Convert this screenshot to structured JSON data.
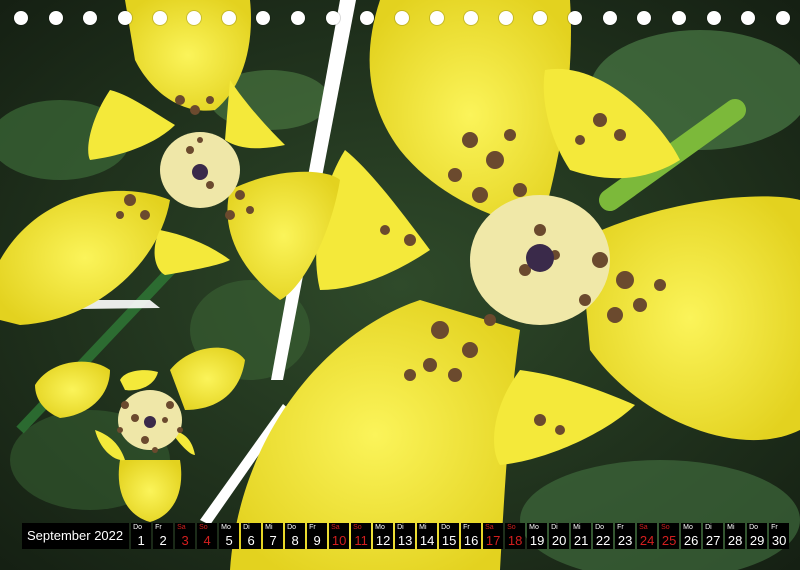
{
  "calendar": {
    "month_label": "September 2022",
    "days": [
      {
        "wd": "Do",
        "num": "1",
        "weekend": false
      },
      {
        "wd": "Fr",
        "num": "2",
        "weekend": false
      },
      {
        "wd": "Sa",
        "num": "3",
        "weekend": true
      },
      {
        "wd": "So",
        "num": "4",
        "weekend": true
      },
      {
        "wd": "Mo",
        "num": "5",
        "weekend": false
      },
      {
        "wd": "Di",
        "num": "6",
        "weekend": false
      },
      {
        "wd": "Mi",
        "num": "7",
        "weekend": false
      },
      {
        "wd": "Do",
        "num": "8",
        "weekend": false
      },
      {
        "wd": "Fr",
        "num": "9",
        "weekend": false
      },
      {
        "wd": "Sa",
        "num": "10",
        "weekend": true
      },
      {
        "wd": "So",
        "num": "11",
        "weekend": true
      },
      {
        "wd": "Mo",
        "num": "12",
        "weekend": false
      },
      {
        "wd": "Di",
        "num": "13",
        "weekend": false
      },
      {
        "wd": "Mi",
        "num": "14",
        "weekend": false
      },
      {
        "wd": "Do",
        "num": "15",
        "weekend": false
      },
      {
        "wd": "Fr",
        "num": "16",
        "weekend": false
      },
      {
        "wd": "Sa",
        "num": "17",
        "weekend": true
      },
      {
        "wd": "So",
        "num": "18",
        "weekend": true
      },
      {
        "wd": "Mo",
        "num": "19",
        "weekend": false
      },
      {
        "wd": "Di",
        "num": "20",
        "weekend": false
      },
      {
        "wd": "Mi",
        "num": "21",
        "weekend": false
      },
      {
        "wd": "Do",
        "num": "22",
        "weekend": false
      },
      {
        "wd": "Fr",
        "num": "23",
        "weekend": false
      },
      {
        "wd": "Sa",
        "num": "24",
        "weekend": true
      },
      {
        "wd": "So",
        "num": "25",
        "weekend": true
      },
      {
        "wd": "Mo",
        "num": "26",
        "weekend": false
      },
      {
        "wd": "Di",
        "num": "27",
        "weekend": false
      },
      {
        "wd": "Mi",
        "num": "28",
        "weekend": false
      },
      {
        "wd": "Do",
        "num": "29",
        "weekend": false
      },
      {
        "wd": "Fr",
        "num": "30",
        "weekend": false
      }
    ]
  },
  "binding": {
    "hole_count": 23
  },
  "colors": {
    "petal_yellow": "#f2e82e",
    "spot_brown": "#6b4a2e",
    "leaf_green": "#3f6e3a",
    "dark_background": "#1e2a1c",
    "strip_black": "#000000",
    "weekend_red": "#d41f1f"
  }
}
